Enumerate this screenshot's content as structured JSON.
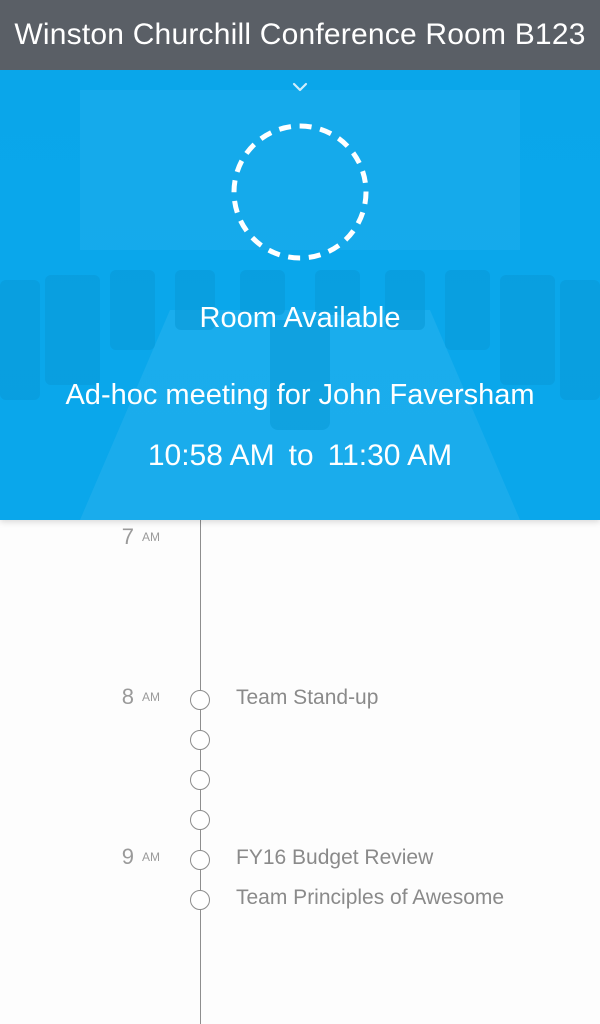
{
  "header": {
    "title": "Winston Churchill Conference Room B123"
  },
  "status": {
    "label": "Room Available",
    "meeting_title": "Ad-hoc meeting for John Faversham",
    "start_time": "10:58 AM",
    "to_word": "to",
    "end_time": "11:30 AM",
    "icon": "chevron-down-icon"
  },
  "colors": {
    "header_bg": "#5a5f66",
    "hero_bg": "#0aa7eb",
    "text_light": "#ffffff",
    "timeline_text": "#8a8a8a"
  },
  "timeline": {
    "hours": [
      {
        "num": "7",
        "ampm": "AM"
      },
      {
        "num": "8",
        "ampm": "AM"
      },
      {
        "num": "9",
        "ampm": "AM"
      }
    ],
    "events": [
      {
        "title": "Team Stand-up"
      },
      {
        "title": "FY16 Budget Review"
      },
      {
        "title": "Team Principles of Awesome"
      }
    ]
  }
}
